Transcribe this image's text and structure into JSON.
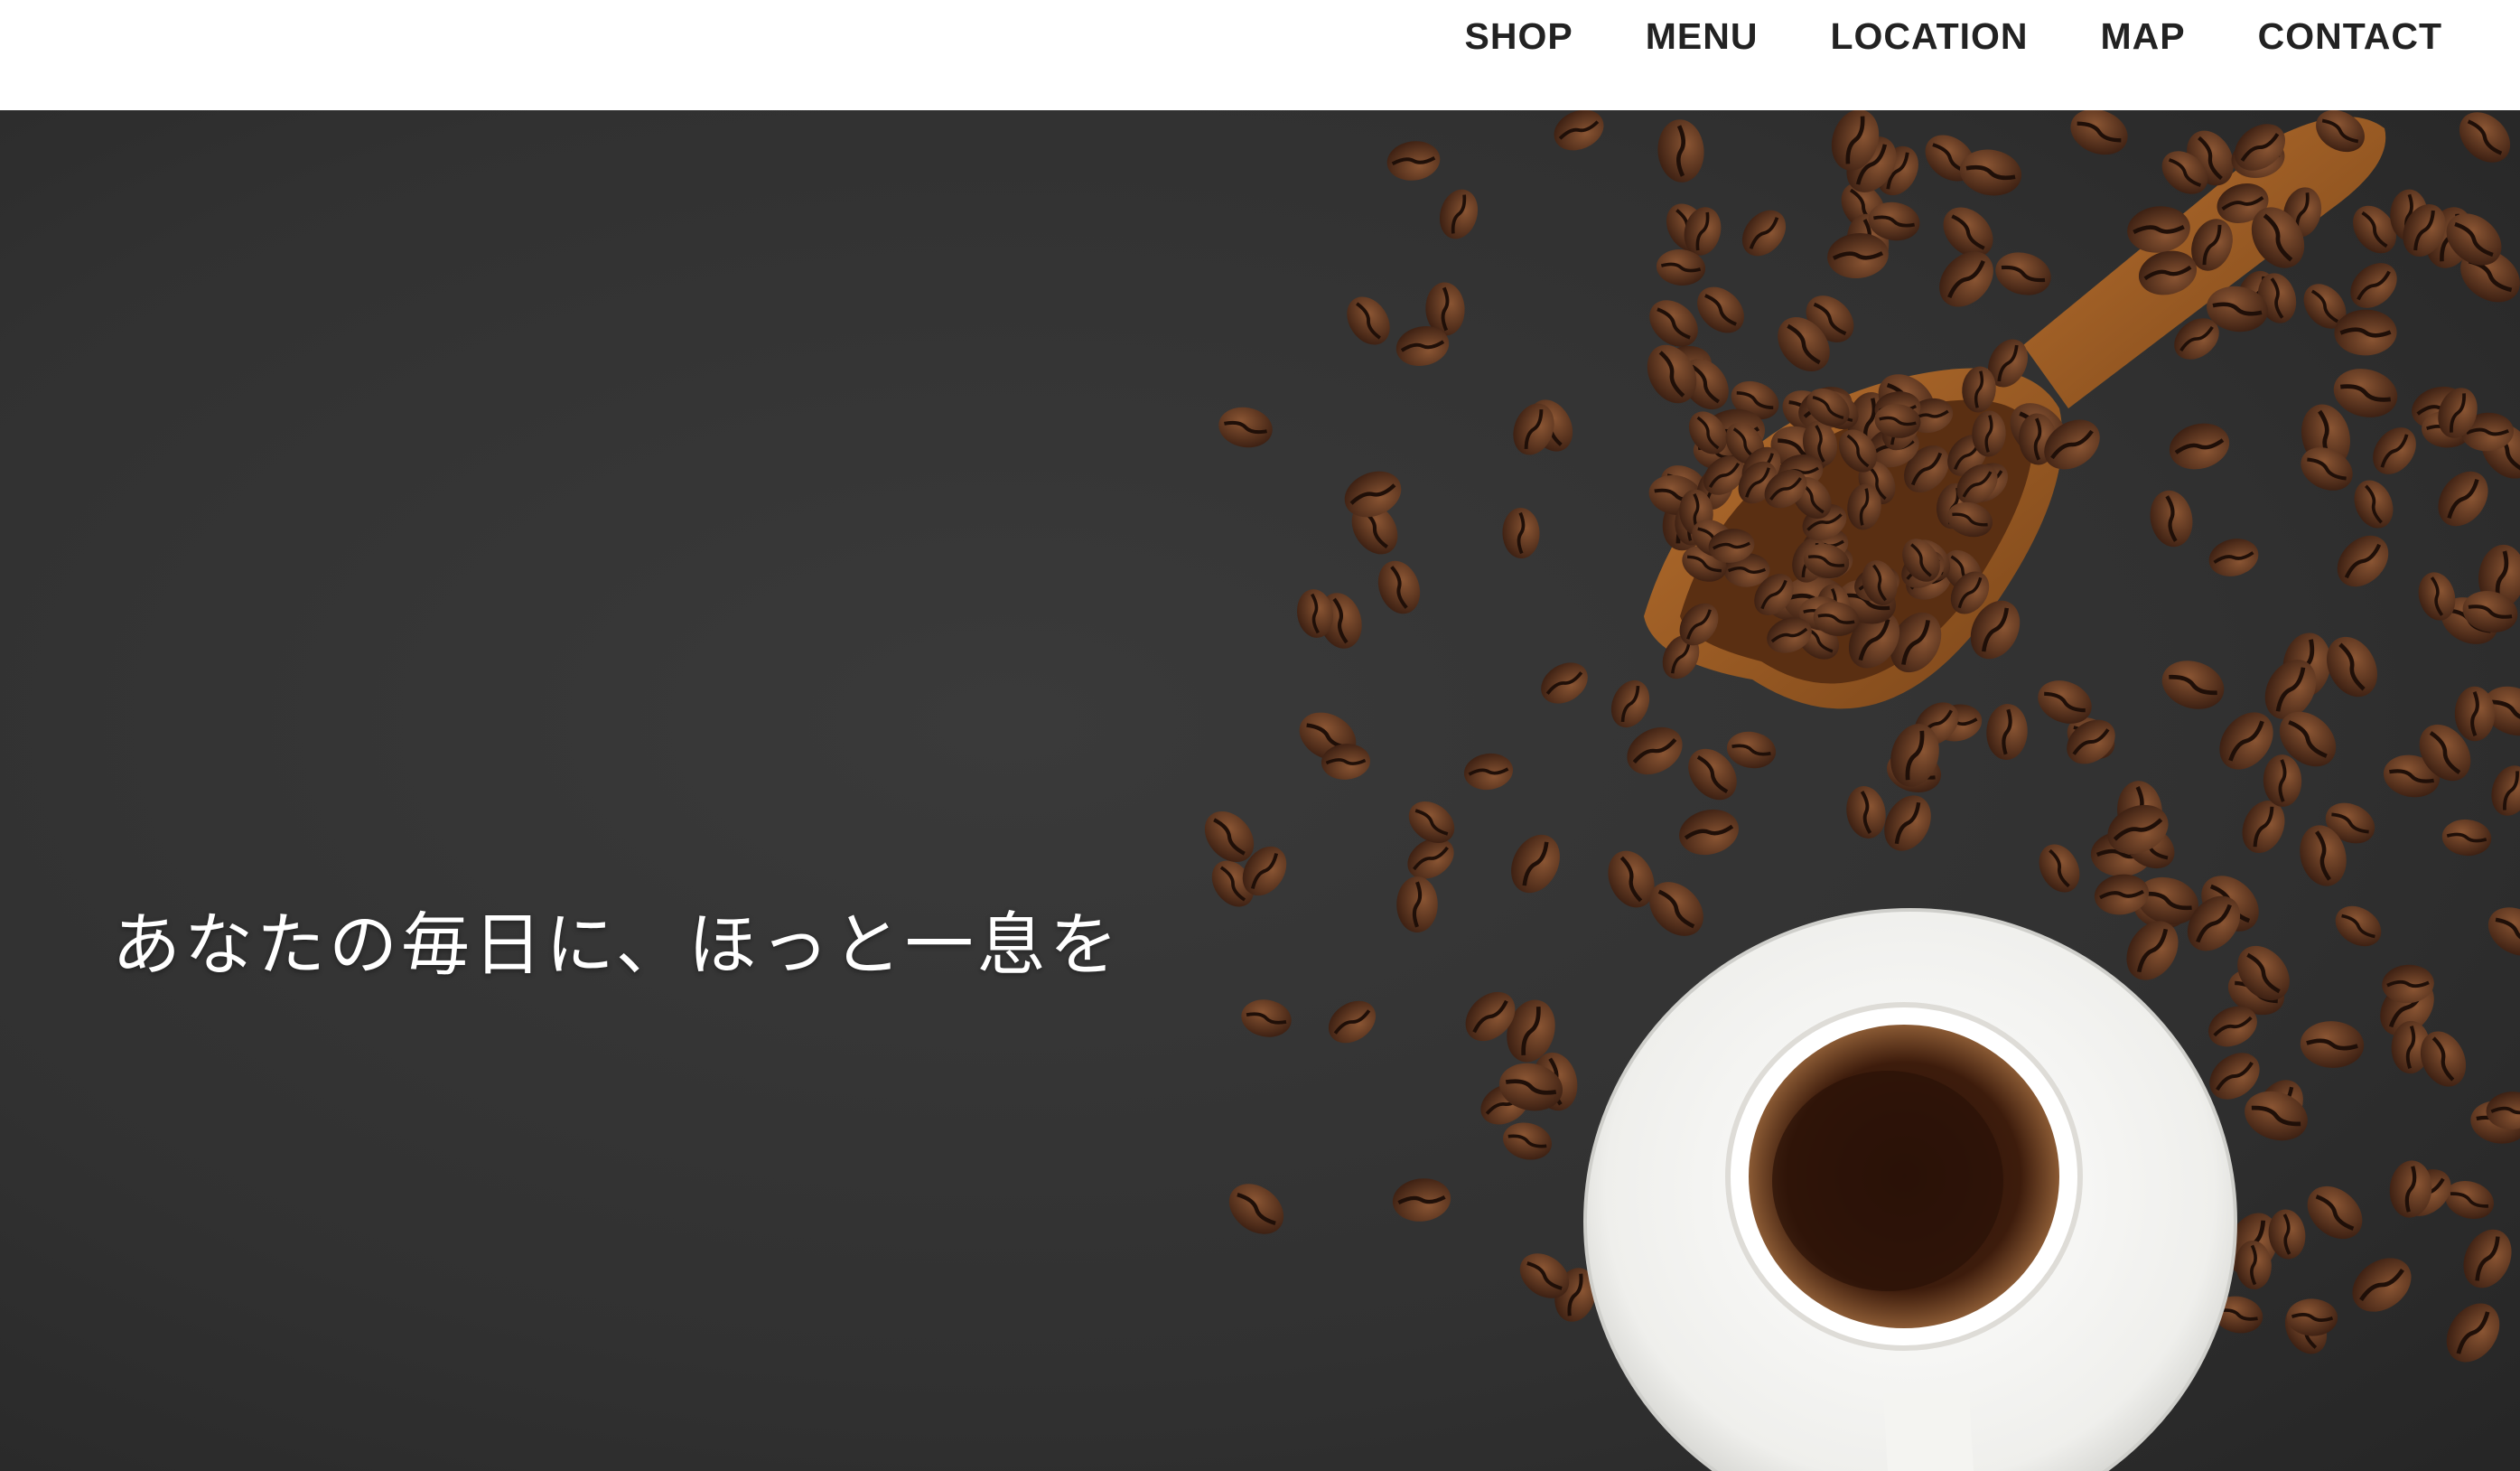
{
  "nav": {
    "items": [
      {
        "label": "SHOP"
      },
      {
        "label": "MENU"
      },
      {
        "label": "LOCATION"
      },
      {
        "label": "MAP"
      },
      {
        "label": "CONTACT"
      }
    ]
  },
  "hero": {
    "tagline": "あなたの毎日に、ほっと一息を",
    "image": "coffee-beans-scoop-espresso-cup-photo"
  },
  "colors": {
    "background": "#ffffff",
    "nav_text": "#222222",
    "hero_board": "#333333",
    "bean": "#5a3320",
    "scoop": "#9a5a24",
    "cup": "#f7f7f5",
    "coffee": "#3a1a0c"
  }
}
